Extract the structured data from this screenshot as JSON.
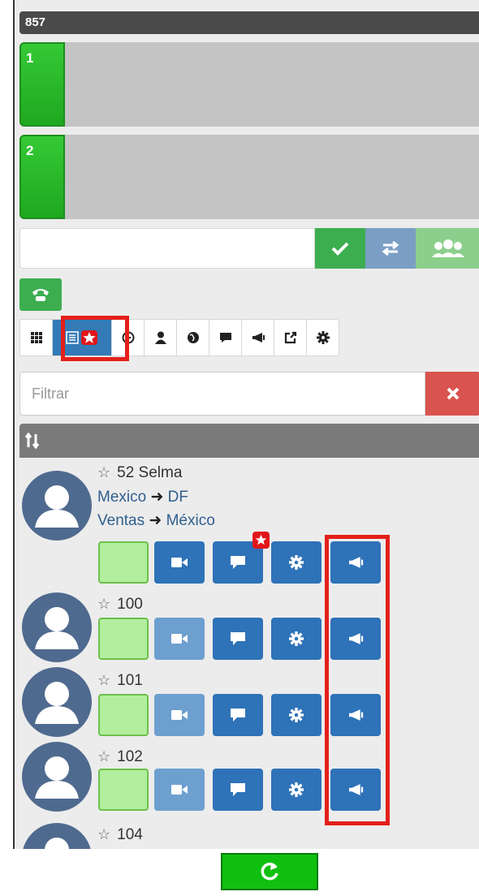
{
  "extension": "857",
  "lines": [
    {
      "number": "1"
    },
    {
      "number": "2"
    }
  ],
  "dial": {
    "input_value": "",
    "buttons": [
      {
        "icon": "checkmark-icon",
        "color": "#3dae50"
      },
      {
        "icon": "transfer-arrows-icon",
        "color": "#7b9fc4"
      },
      {
        "icon": "conference-users-icon",
        "color": "#8ccf8c"
      }
    ],
    "hangup_icon": "phone-icon"
  },
  "tabs": [
    {
      "icon": "keypad-grid-icon"
    },
    {
      "icon": "favorites-list-star-icon",
      "active": true
    },
    {
      "icon": "clock-history-icon"
    },
    {
      "icon": "user-icon"
    },
    {
      "icon": "globe-icon"
    },
    {
      "icon": "chat-bubble-icon"
    },
    {
      "icon": "megaphone-icon"
    },
    {
      "icon": "share-external-icon"
    },
    {
      "icon": "gear-icon"
    }
  ],
  "filter": {
    "placeholder": "Filtrar"
  },
  "contacts": [
    {
      "name": "52 Selma",
      "location_from": "Mexico",
      "location_to": "DF",
      "dept_from": "Ventas",
      "dept_to": "México",
      "video_enabled": true,
      "chat_badge": true
    },
    {
      "name": "100",
      "video_enabled": false
    },
    {
      "name": "101",
      "video_enabled": false
    },
    {
      "name": "102",
      "video_enabled": false
    },
    {
      "name": "104",
      "video_enabled": false
    }
  ],
  "colors": {
    "status_green": "#b3ee9e",
    "action_blue": "#2e72b8",
    "disabled_blue": "#6d9fcf",
    "highlight_red": "#e4201a"
  }
}
